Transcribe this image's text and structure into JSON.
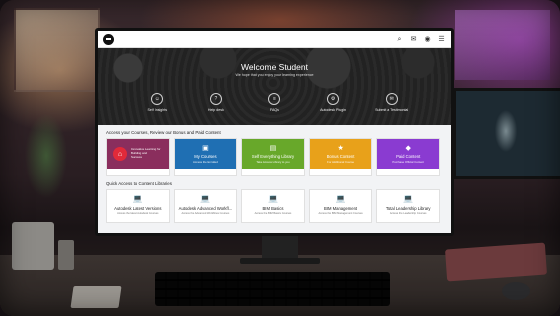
{
  "hero": {
    "title": "Welcome Student",
    "subtitle": "We hope that you enjoy your learning experience",
    "links": [
      {
        "label": "Self Insights",
        "icon": "user-insight-icon",
        "glyph": "☺"
      },
      {
        "label": "Help desk",
        "icon": "help-icon",
        "glyph": "?"
      },
      {
        "label": "FAQs",
        "icon": "faq-icon",
        "glyph": "≡"
      },
      {
        "label": "Autodesk Plugin",
        "icon": "plugin-icon",
        "glyph": "⚙"
      },
      {
        "label": "Submit a Testimonial",
        "icon": "testimonial-icon",
        "glyph": "✉"
      }
    ]
  },
  "topbar": {
    "icons": [
      {
        "name": "search-icon",
        "glyph": "⌕"
      },
      {
        "name": "message-icon",
        "glyph": "✉"
      },
      {
        "name": "profile-icon",
        "glyph": "◉"
      },
      {
        "name": "menu-icon",
        "glyph": "☰"
      }
    ]
  },
  "courses_section": {
    "title": "Access your Courses, Review our Bonus and Paid Content",
    "featured": {
      "text_line1": "Innovative Learning for",
      "text_line2": "Building and",
      "text_line3": "Success",
      "glyph": "⌂"
    },
    "cards": [
      {
        "name": "My Courses",
        "desc": "Access the Enrolled",
        "color": "#1f6fb3",
        "glyph": "▣"
      },
      {
        "name": "Self Everything Library",
        "desc": "Take Access Library to you",
        "color": "#68a82a",
        "glyph": "▤"
      },
      {
        "name": "Bonus Content",
        "desc": "For Additional Course",
        "color": "#e8a11a",
        "glyph": "★"
      },
      {
        "name": "Paid Content",
        "desc": "Purchase Official Content",
        "color": "#8a3bd1",
        "glyph": "◆"
      }
    ]
  },
  "quick_section": {
    "title": "Quick Access to Content Libraries",
    "cards": [
      {
        "name": "Autodesk Latest Versions",
        "desc": "Access the latest Autodesk Courses"
      },
      {
        "name": "Autodesk Advanced Workfl...",
        "desc": "Access the Advanced Workflows Courses"
      },
      {
        "name": "BIM Basics",
        "desc": "Access the BIM Basics Courses"
      },
      {
        "name": "BIM Management",
        "desc": "Access the BIM Management Courses"
      },
      {
        "name": "Total Leadership Library",
        "desc": "Access the Leadership Courses"
      }
    ]
  }
}
